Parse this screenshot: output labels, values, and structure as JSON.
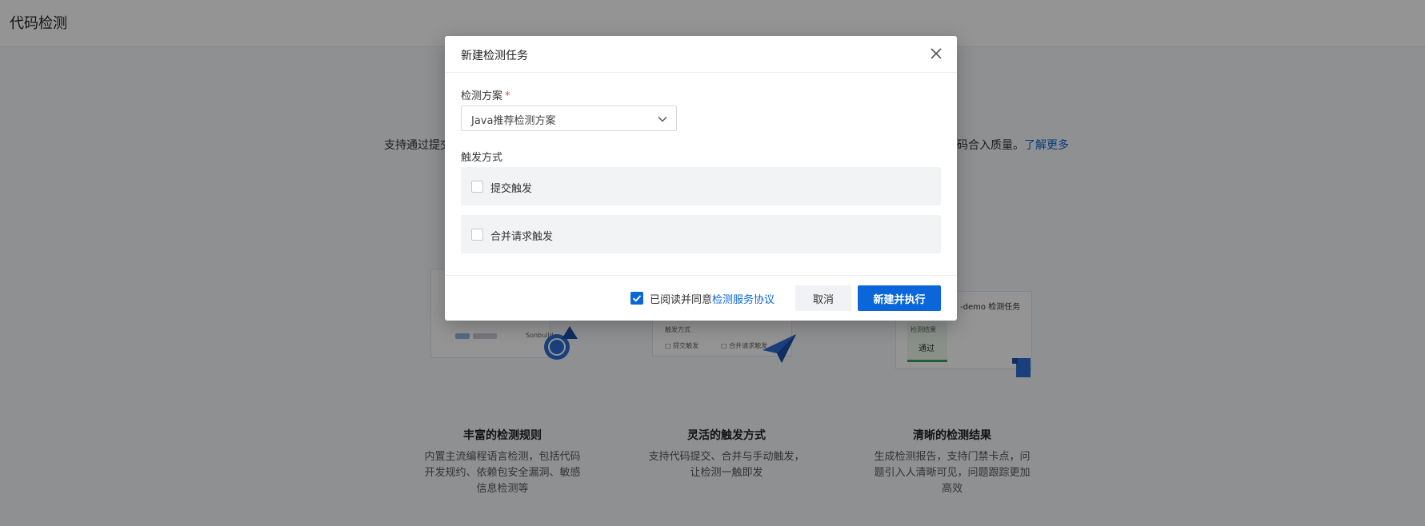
{
  "page": {
    "title": "代码检测",
    "intro_start": "支持通过提交",
    "intro_end": "码合入质量。",
    "learn_more": "了解更多"
  },
  "features": [
    {
      "title": "丰富的检测规则",
      "desc": [
        "内置主流编程语言检测，包括代码",
        "开发规约、依赖包安全漏洞、敏感",
        "信息检测等"
      ]
    },
    {
      "title": "灵活的触发方式",
      "desc": [
        "支持代码提交、合并与手动触发，",
        "让检测一触即发"
      ]
    },
    {
      "title": "清晰的检测结果",
      "desc": [
        "生成检测报告，支持门禁卡点，问",
        "题引入人清晰可见，问题跟踪更加",
        "高效"
      ]
    }
  ],
  "illustrations": {
    "f2_trigger_title": "触发方式",
    "f2_opt1": "提交触发",
    "f2_opt2": "合并请求触发",
    "f3_title": "-demo 检测任务",
    "f3_result_label": "检测结果",
    "f3_result_value": "通过"
  },
  "modal": {
    "title": "新建检测任务",
    "scheme_label": "检测方案",
    "required_mark": "*",
    "scheme_value": "Java推荐检测方案",
    "trigger_label": "触发方式",
    "trigger_options": [
      {
        "label": "提交触发",
        "checked": false
      },
      {
        "label": "合并请求触发",
        "checked": false
      }
    ],
    "agree_prefix": "已阅读并同意",
    "agree_link": "检测服务协议",
    "agree_checked": true,
    "cancel_label": "取消",
    "submit_label": "新建并执行"
  },
  "colors": {
    "primary": "#0b67d9",
    "mask": "rgba(0,0,0,0.42)"
  }
}
